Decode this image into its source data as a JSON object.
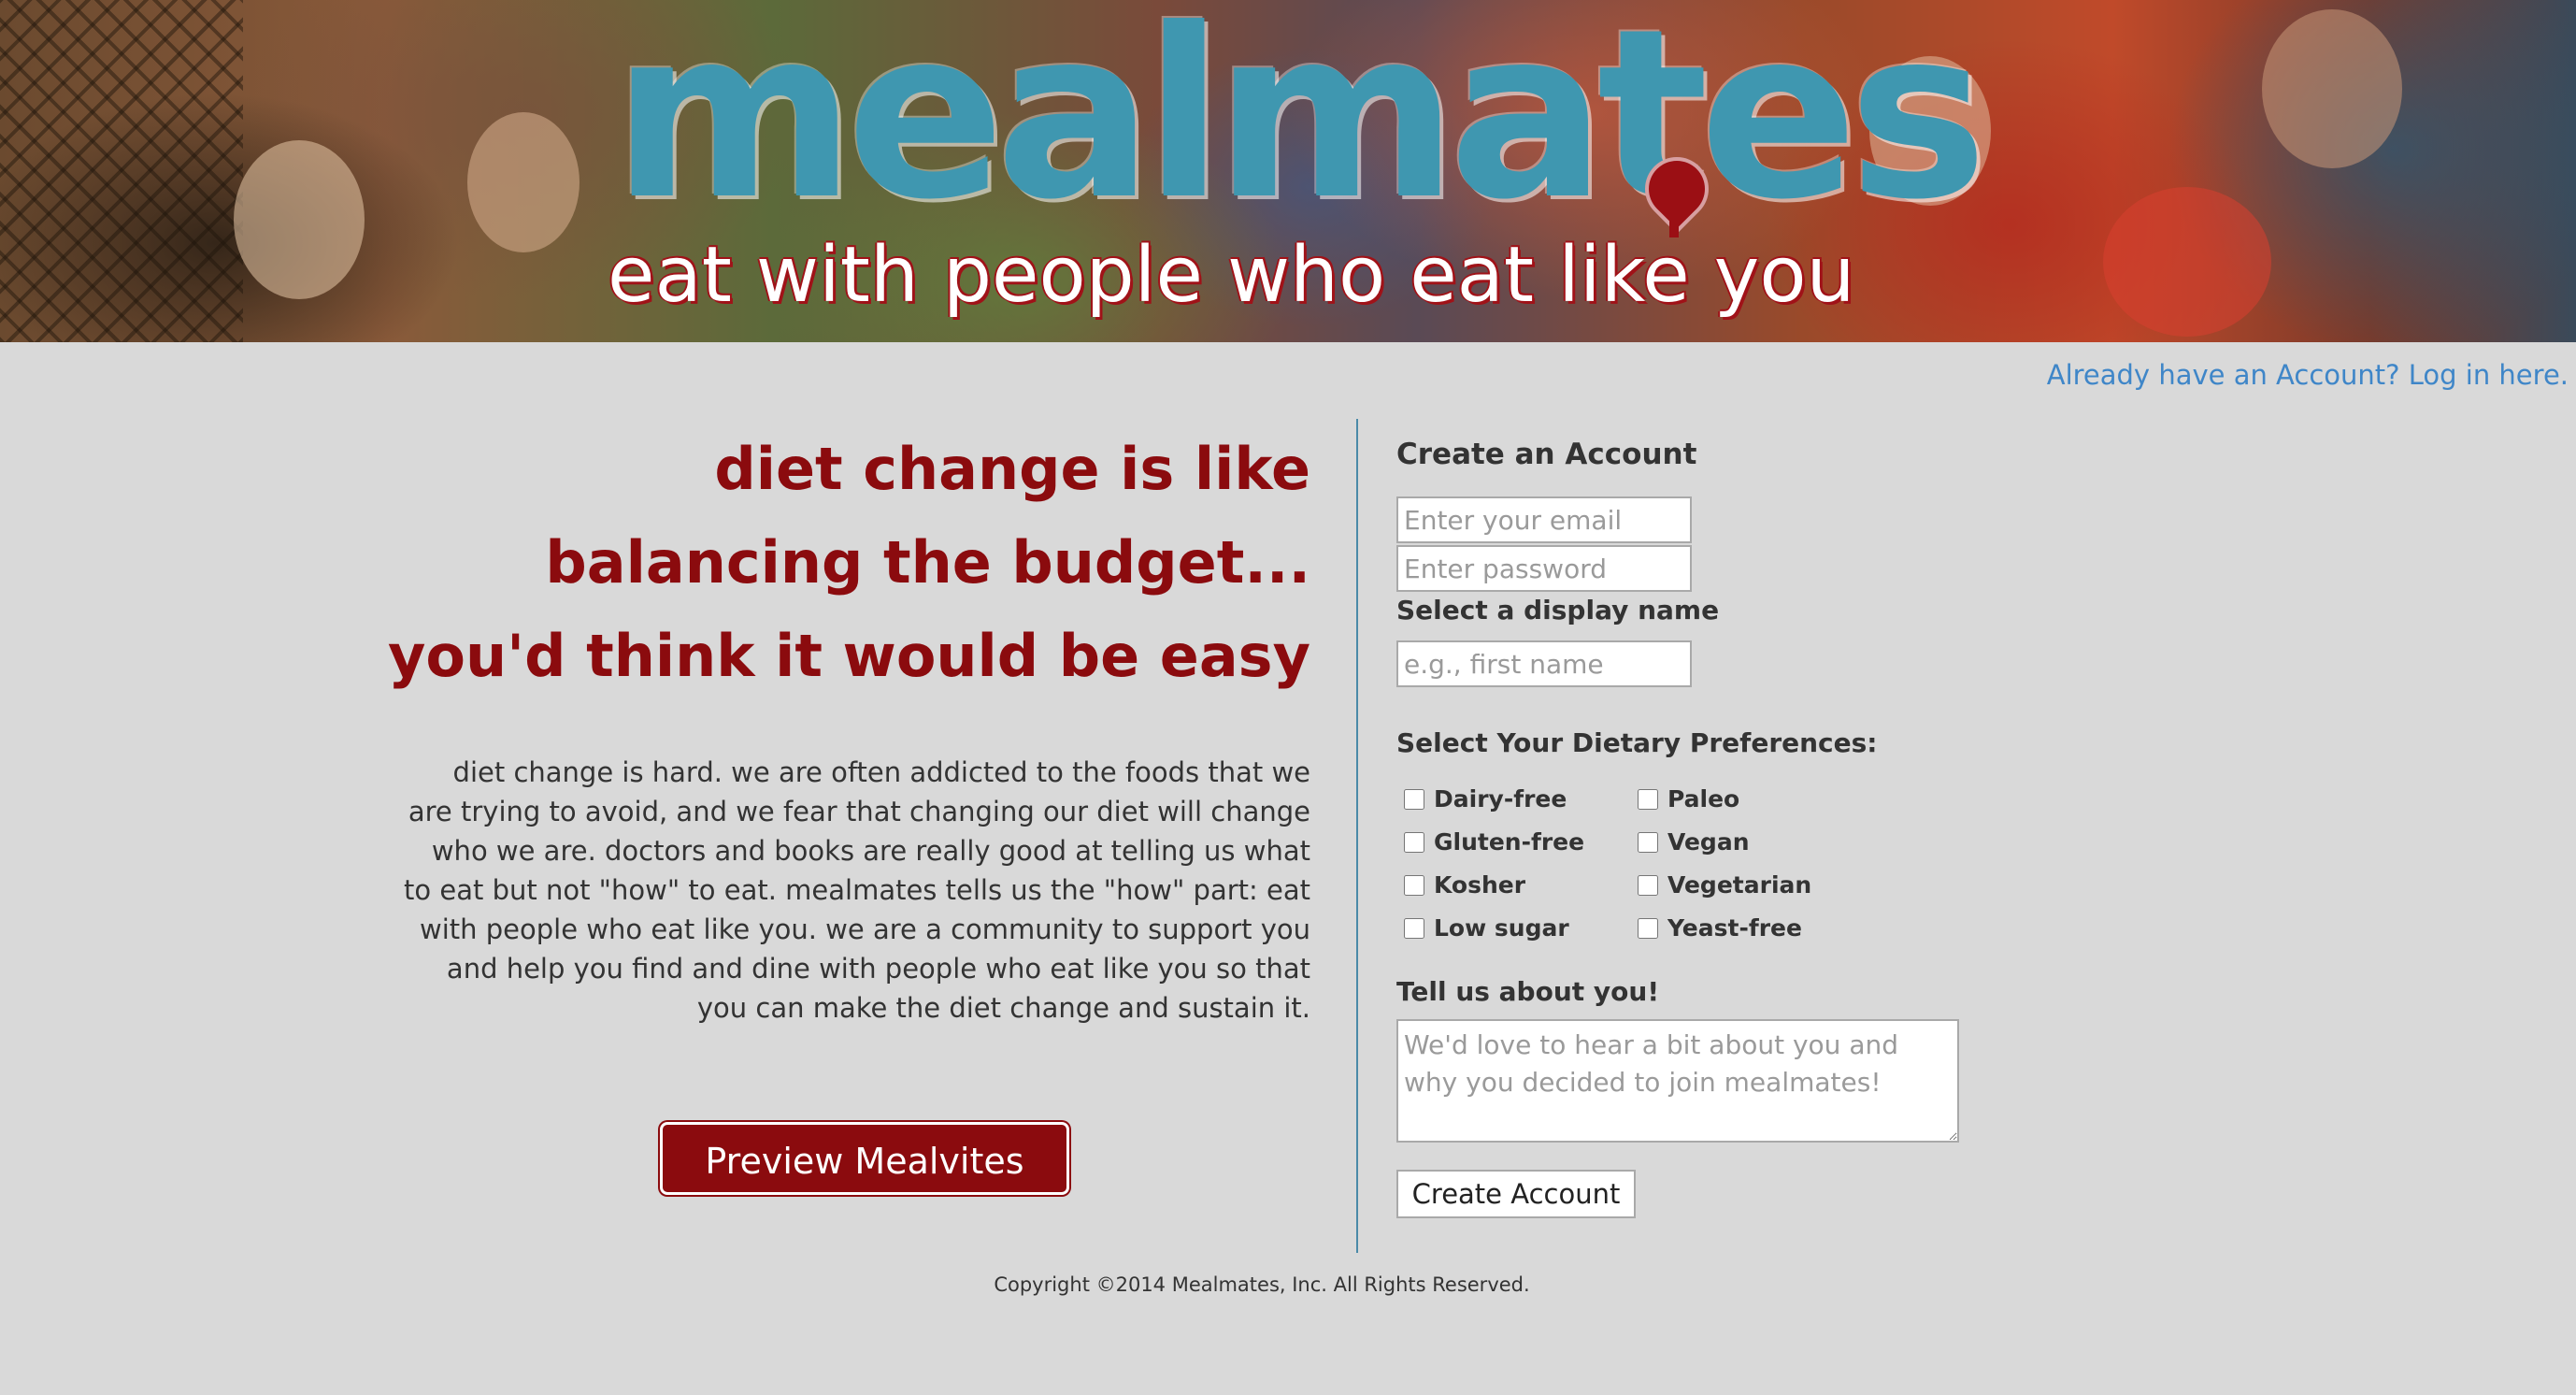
{
  "hero": {
    "logo_text": "mealmates",
    "tagline": "eat with people who eat like you"
  },
  "login_link": "Already have an Account? Log in here.",
  "headline": {
    "line1": "diet change is like",
    "line2": "balancing the budget...",
    "line3": "you'd think it would be easy"
  },
  "blurb": "diet change is hard. we are often addicted to the foods that we are trying to avoid, and we fear that changing our diet will change who we are. doctors and books are really good at telling us what to eat but not \"how\" to eat. mealmates tells us the \"how\" part: eat with people who eat like you. we are a community to support you and help you find and dine with people who eat like you so that you can make the diet change and sustain it.",
  "preview_button": "Preview Mealvites",
  "form": {
    "title": "Create an Account",
    "email_placeholder": "Enter your email",
    "password_placeholder": "Enter password",
    "display_name_label": "Select a display name",
    "display_name_placeholder": "e.g., first name",
    "preferences_label": "Select Your Dietary Preferences:",
    "preferences": {
      "col1": [
        "Dairy-free",
        "Gluten-free",
        "Kosher",
        "Low sugar"
      ],
      "col2": [
        "Paleo",
        "Vegan",
        "Vegetarian",
        "Yeast-free"
      ]
    },
    "about_label": "Tell us about you!",
    "about_placeholder": "We'd love to hear a bit about you and why you decided to join mealmates!",
    "submit_label": "Create Account"
  },
  "footer": "Copyright ©2014 Mealmates, Inc. All Rights Reserved.",
  "colors": {
    "accent_red": "#8b0b0e",
    "logo_teal": "#3f97b0",
    "link_blue": "#3f86c8",
    "page_bg": "#d9d9d9"
  }
}
